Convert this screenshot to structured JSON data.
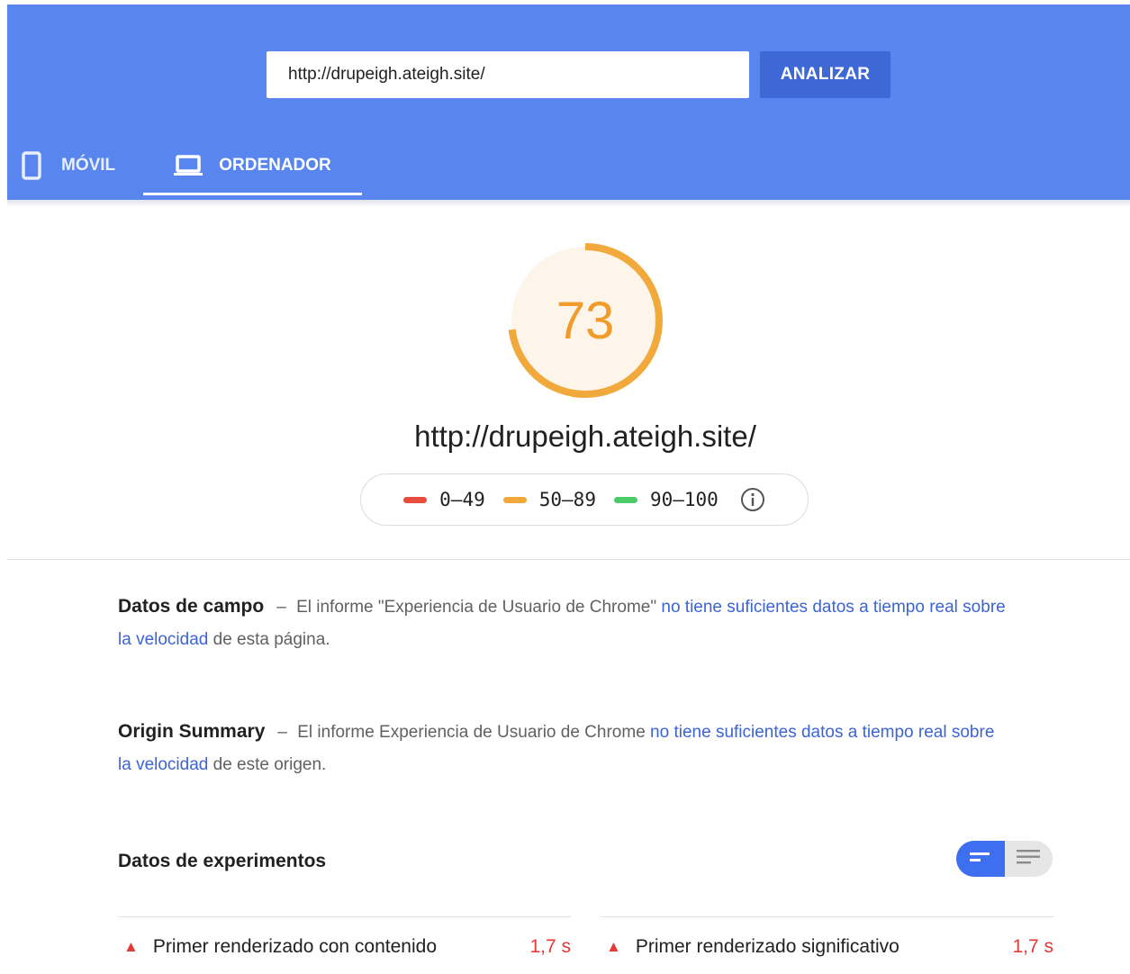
{
  "search": {
    "value": "http://drupeigh.ateigh.site/",
    "button_label": "ANALIZAR"
  },
  "tabs": [
    {
      "label": "MÓVIL",
      "icon": "phone-icon",
      "active": false
    },
    {
      "label": "ORDENADOR",
      "icon": "laptop-icon",
      "active": true
    }
  ],
  "score": {
    "value": "73",
    "fraction": 0.73,
    "color": "#f0a93a",
    "url": "http://drupeigh.ateigh.site/"
  },
  "legend": [
    {
      "range": "0–49",
      "color": "#e74c3c"
    },
    {
      "range": "50–89",
      "color": "#f0a93a"
    },
    {
      "range": "90–100",
      "color": "#4ccb6b"
    }
  ],
  "field_data": {
    "heading": "Datos de campo",
    "dash": "–",
    "text_before": "El informe \"Experiencia de Usuario de Chrome\"",
    "link": "no tiene suficientes datos a tiempo real sobre la velocidad",
    "text_after": "de esta página."
  },
  "origin_summary": {
    "heading": "Origin Summary",
    "dash": "–",
    "text_before": "El informe Experiencia de Usuario de Chrome",
    "link": "no tiene suficientes datos a tiempo real sobre la velocidad",
    "text_after": "de este origen."
  },
  "lab_data": {
    "heading": "Datos de experimentos",
    "metrics": [
      {
        "label": "Primer renderizado con contenido",
        "value": "1,7 s",
        "status_icon": "warning-triangle-icon"
      },
      {
        "label": "Primer renderizado significativo",
        "value": "1,7 s",
        "status_icon": "warning-triangle-icon"
      }
    ]
  }
}
